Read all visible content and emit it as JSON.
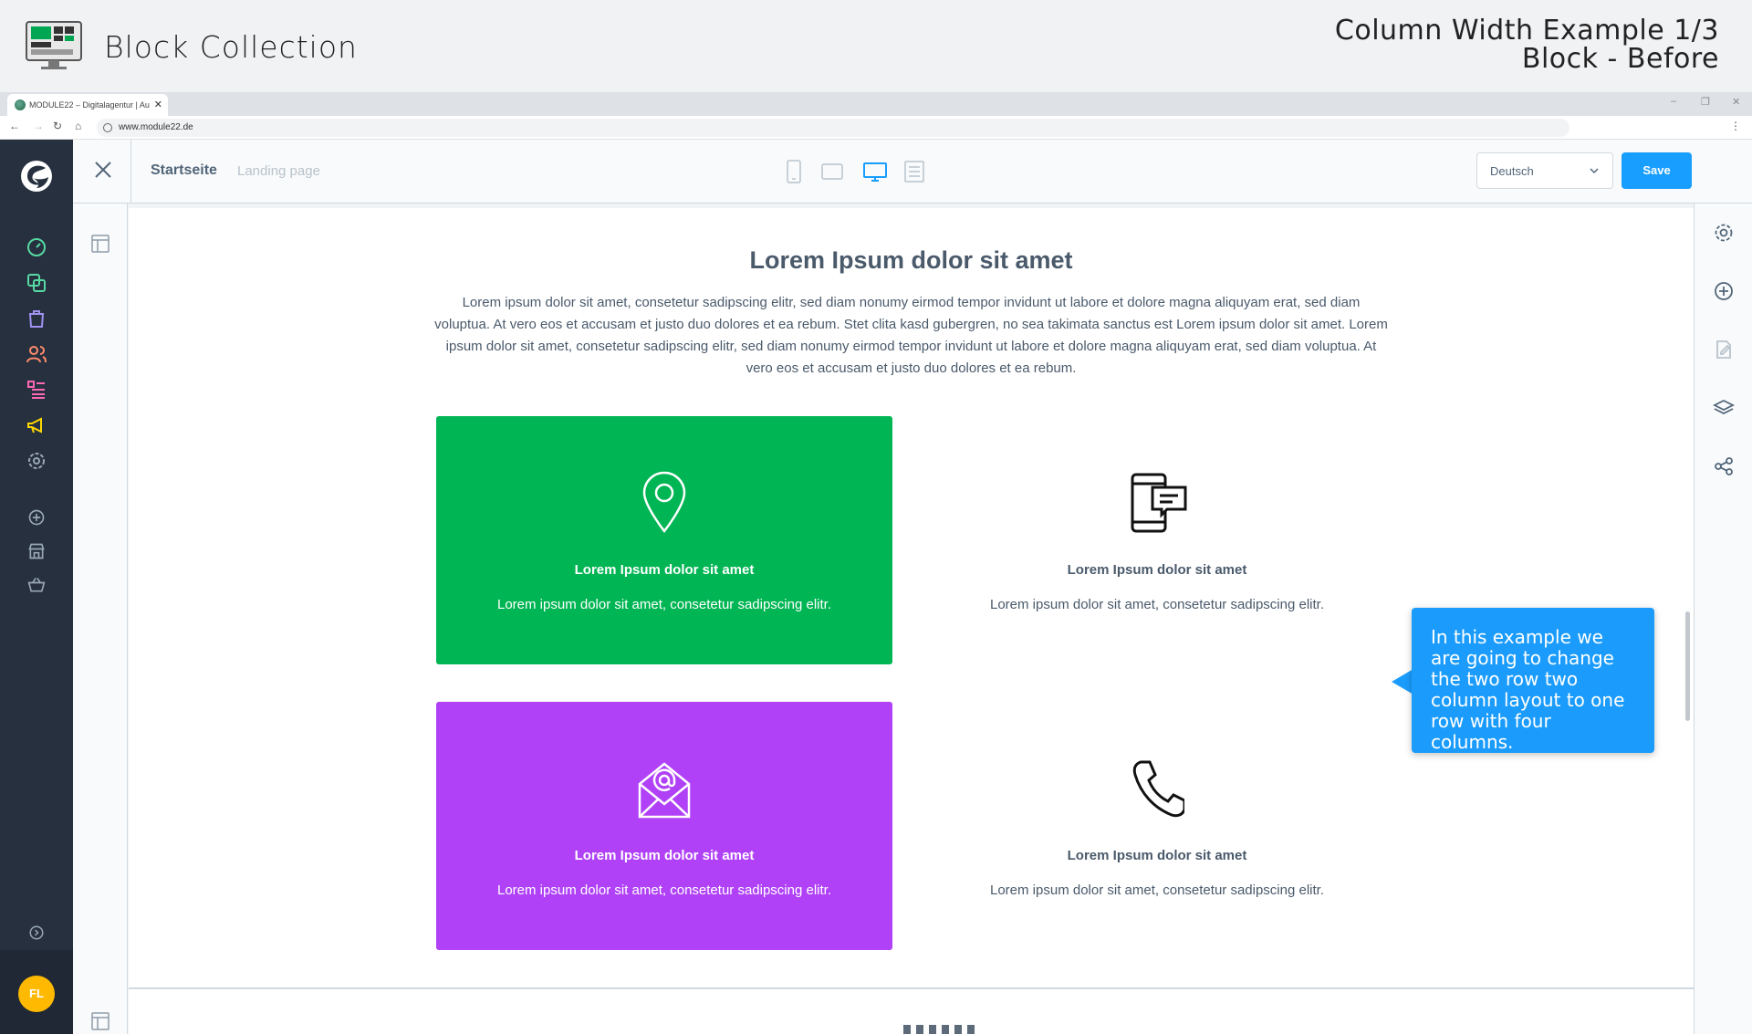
{
  "presentation": {
    "title": "Block Collection",
    "subtitle_line1": "Column Width Example 1/3",
    "subtitle_line2": "Block - Before"
  },
  "browser": {
    "tab_title": "MODULE22 – Digitalagentur | Au",
    "url": "www.module22.de"
  },
  "editor": {
    "page_name": "Startseite",
    "page_type": "Landing page",
    "language": "Deutsch",
    "save_label": "Save",
    "active_device": "desktop"
  },
  "user": {
    "initials": "FL"
  },
  "section": {
    "title": "Lorem Ipsum dolor sit amet",
    "text": "Lorem ipsum dolor sit amet, consetetur sadipscing elitr, sed diam nonumy eirmod tempor invidunt ut labore et dolore magna aliquyam erat, sed diam voluptua. At vero eos et accusam et justo duo dolores et ea rebum. Stet clita kasd gubergren, no sea takimata sanctus est Lorem ipsum dolor sit amet. Lorem ipsum dolor sit amet, consetetur sadipscing elitr, sed diam nonumy eirmod tempor invidunt ut labore et dolore magna aliquyam erat, sed diam voluptua. At vero eos et accusam et justo duo dolores et ea rebum."
  },
  "cards": [
    {
      "icon": "map-pin-icon",
      "title": "Lorem Ipsum dolor sit amet",
      "text": "Lorem ipsum dolor sit amet, consetetur sadipscing elitr.",
      "bg": "#00b553",
      "fg": "#ffffff"
    },
    {
      "icon": "mobile-chat-icon",
      "title": "Lorem Ipsum dolor sit amet",
      "text": "Lorem ipsum dolor sit amet, consetetur sadipscing elitr.",
      "bg": "#ffffff",
      "fg": "#4a5a6b"
    },
    {
      "icon": "email-at-icon",
      "title": "Lorem Ipsum dolor sit amet",
      "text": "Lorem ipsum dolor sit amet, consetetur sadipscing elitr.",
      "bg": "#b041f7",
      "fg": "#ffffff"
    },
    {
      "icon": "phone-icon",
      "title": "Lorem Ipsum dolor sit amet",
      "text": "Lorem ipsum dolor sit amet, consetetur sadipscing elitr.",
      "bg": "#ffffff",
      "fg": "#4a5a6b"
    }
  ],
  "callout": {
    "text": "In this example we are going to change the two row two column layout to one row with four columns."
  },
  "colors": {
    "accent": "#189eff",
    "sidebar": "#26303f",
    "green_card": "#00b553",
    "purple_card": "#b041f7"
  }
}
